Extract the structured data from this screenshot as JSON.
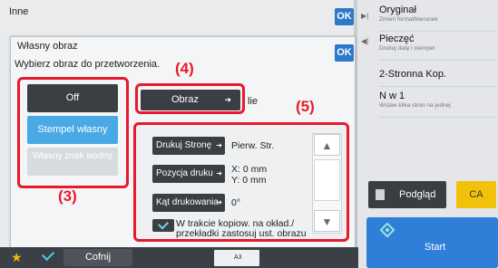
{
  "base": {
    "title": "Inne",
    "ok": "OK"
  },
  "dialog": {
    "title": "Własny obraz",
    "ok": "OK",
    "instruction": "Wybierz obraz do przetworzenia.",
    "options": {
      "off": "Off",
      "stamp": "Stempel własny",
      "watermark": "Własny znak wodny"
    },
    "obraz_button": "Obraz",
    "obraz_suffix": "lie",
    "settings": [
      {
        "label": "Drukuj Stronę",
        "value": "Pierw. Str."
      },
      {
        "label": "Pozycja druku",
        "value_line1": "X: 0 mm",
        "value_line2": "Y: 0 mm"
      },
      {
        "label": "Kąt drukowania",
        "value": "0°"
      }
    ],
    "checkbox_text": "W trakcie kopiow. na okład./ przekładki zastosuj ust. obrazu"
  },
  "callouts": {
    "c3": "(3)",
    "c4": "(4)",
    "c5": "(5)"
  },
  "sidebar": {
    "items": [
      {
        "title": "Oryginał",
        "sub": "Zmień format/kierunek"
      },
      {
        "title": "Pieczęć",
        "sub": "Drukuj datę i stempel"
      },
      {
        "title": "2-Stronna Kop.",
        "sub": ""
      },
      {
        "title": "N w 1",
        "sub": "Wstaw kilka stron na jednej"
      }
    ],
    "preview": "Podgląd",
    "ca": "CA",
    "start": "Start"
  },
  "bottom": {
    "back": "Cofnij",
    "paper": "A3"
  },
  "colors": {
    "accent": "#2f7fd8",
    "callout": "#e8192c",
    "selected": "#48a9e4",
    "ca": "#f2c20b"
  }
}
